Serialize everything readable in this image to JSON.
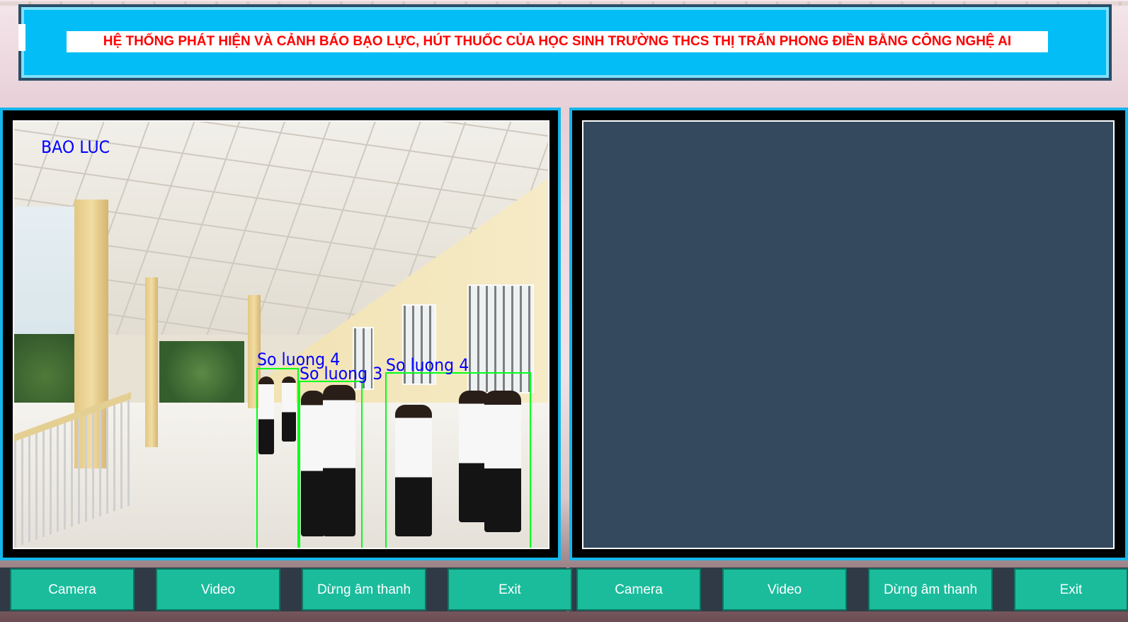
{
  "title": "HỆ THỐNG PHÁT HIỆN VÀ CẢNH BÁO BẠO LỰC, HÚT THUỐC CỦA HỌC SINH TRƯỜNG THCS THỊ TRẤN PHONG ĐIỀN BẰNG CÔNG NGHỆ AI",
  "left_feed": {
    "alert_label": "BAO LUC",
    "detections": [
      {
        "label": "So luong 4"
      },
      {
        "label": "So luong 3"
      },
      {
        "label": "So luong 4"
      }
    ]
  },
  "right_feed": {
    "background": "#34495e"
  },
  "left_controls": {
    "camera": "Camera",
    "video": "Video",
    "stop_sound": "Dừng âm thanh",
    "exit": "Exit"
  },
  "right_controls": {
    "camera": "Camera",
    "video": "Video",
    "stop_sound": "Dừng âm thanh",
    "exit": "Exit"
  },
  "colors": {
    "banner": "#02bdf6",
    "title_text": "#ff0000",
    "panel_border": "#15b6ec",
    "button": "#1abc9c",
    "overlay_text": "#0000ff",
    "detection_box": "#00ff1a"
  }
}
